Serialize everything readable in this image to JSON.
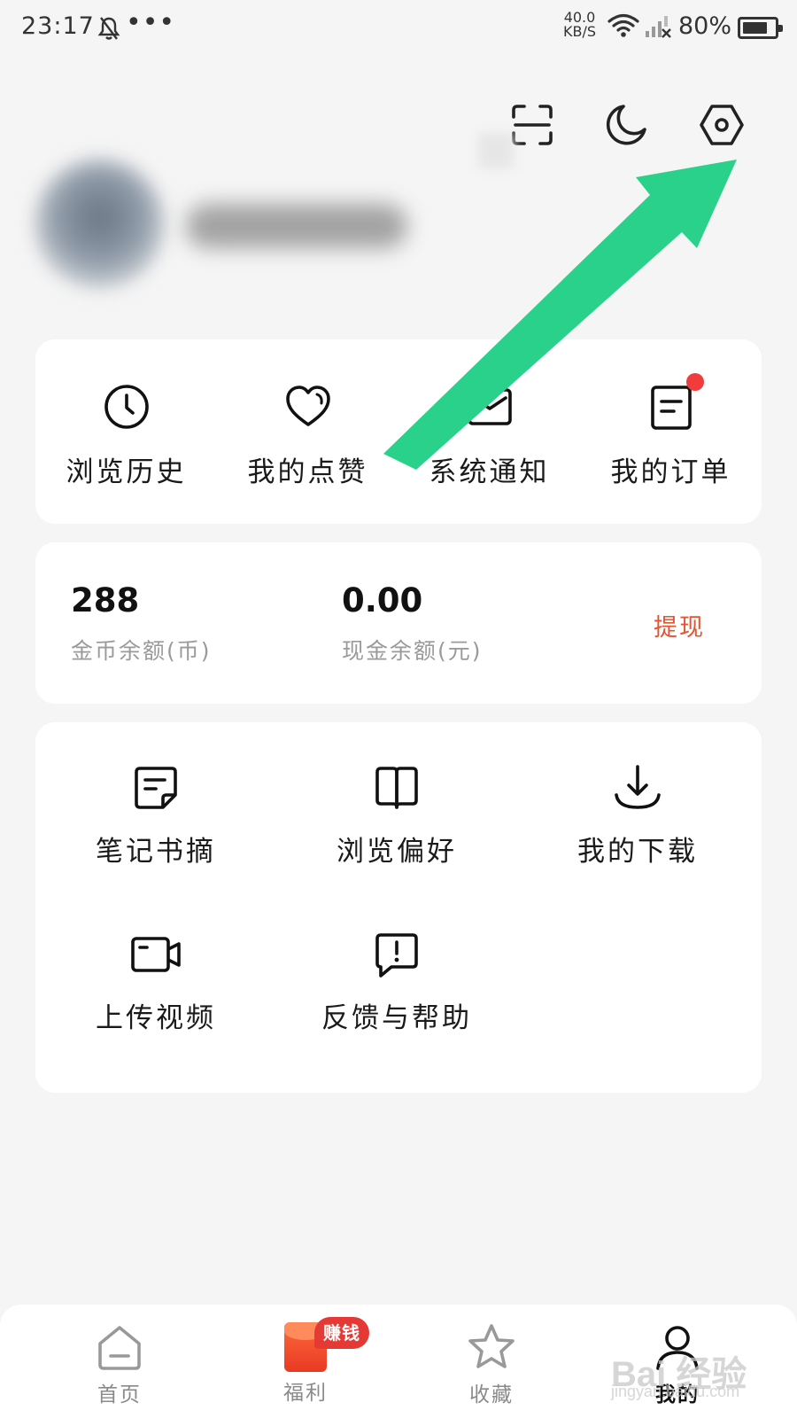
{
  "status_bar": {
    "time": "23:17",
    "dots": "•••",
    "net_speed_value": "40.0",
    "net_speed_unit": "KB/S",
    "battery": "80%",
    "battery_level": 0.8
  },
  "header": {
    "icons": [
      "scan-icon",
      "night-mode-icon",
      "settings-icon"
    ]
  },
  "quick_actions": [
    {
      "label": "浏览历史",
      "icon": "clock-icon"
    },
    {
      "label": "我的点赞",
      "icon": "heart-icon"
    },
    {
      "label": "系统通知",
      "icon": "mail-icon"
    },
    {
      "label": "我的订单",
      "icon": "order-icon",
      "has_dot": true
    }
  ],
  "wallet": {
    "coins_value": "288",
    "coins_label": "金币余额(币)",
    "cash_value": "0.00",
    "cash_label": "现金余额(元)",
    "withdraw_label": "提现"
  },
  "tools": [
    {
      "label": "笔记书摘",
      "icon": "notes-icon"
    },
    {
      "label": "浏览偏好",
      "icon": "book-icon"
    },
    {
      "label": "我的下载",
      "icon": "download-icon"
    },
    {
      "label": "上传视频",
      "icon": "video-camera-icon"
    },
    {
      "label": "反馈与帮助",
      "icon": "feedback-icon"
    }
  ],
  "bottom_nav": {
    "items": [
      {
        "label": "首页",
        "icon": "home-icon"
      },
      {
        "label": "福利",
        "icon": "red-envelope-icon",
        "badge": "赚钱"
      },
      {
        "label": "收藏",
        "icon": "star-icon"
      },
      {
        "label": "我的",
        "icon": "person-icon",
        "active": true
      }
    ]
  },
  "watermark": {
    "text": "Bai 经验",
    "sub": "jingyan.baidu.com"
  },
  "colors": {
    "background": "#f5f5f5",
    "withdraw": "#e5532f",
    "badge": "#e53935",
    "annotation_arrow": "#2ad18a"
  }
}
